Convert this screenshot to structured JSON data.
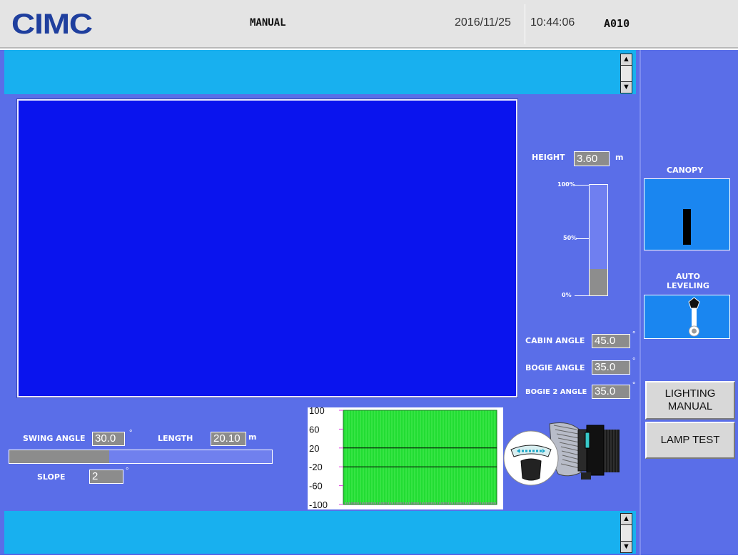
{
  "header": {
    "logo": "CIMC",
    "mode": "MANUAL",
    "date": "2016/11/25",
    "time": "10:44:06",
    "code": "A010"
  },
  "message_bars": {
    "top": "",
    "bottom": ""
  },
  "height": {
    "label": "HEIGHT",
    "value": "3.60",
    "unit": "m",
    "ticks": [
      "100%",
      "50%",
      "0%"
    ],
    "level_percent": 24
  },
  "angles": [
    {
      "label": "CABIN ANGLE",
      "value": "45.0",
      "unit": "°"
    },
    {
      "label": "BOGIE ANGLE",
      "value": "35.0",
      "unit": "°"
    },
    {
      "label": "BOGIE 2 ANGLE",
      "value": "35.0",
      "unit": "°"
    }
  ],
  "swing": {
    "label": "SWING ANGLE",
    "value": "30.0",
    "unit": "°",
    "bar_percent": 38
  },
  "length": {
    "label": "LENGTH",
    "value": "20.10",
    "unit": "m"
  },
  "slope": {
    "label": "SLOPE",
    "value": "2",
    "unit": "°"
  },
  "side": {
    "canopy_label": "CANOPY",
    "auto_leveling_label": "AUTO LEVELING",
    "lighting_button": "LIGHTING MANUAL",
    "lamp_test_button": "LAMP TEST"
  },
  "chart_data": {
    "type": "area",
    "y_ticks": [
      "100",
      "60",
      "20",
      "-20",
      "-60",
      "-100"
    ],
    "ylim": [
      -100,
      100
    ],
    "reference_lines": [
      20,
      -20
    ],
    "fill_color": "#22dd33",
    "fill_range": [
      -100,
      100
    ]
  },
  "colors": {
    "background": "#5a6ee8",
    "message_bar": "#18b0ef",
    "camera": "#0a14ee",
    "panel": "#1a86f0"
  }
}
